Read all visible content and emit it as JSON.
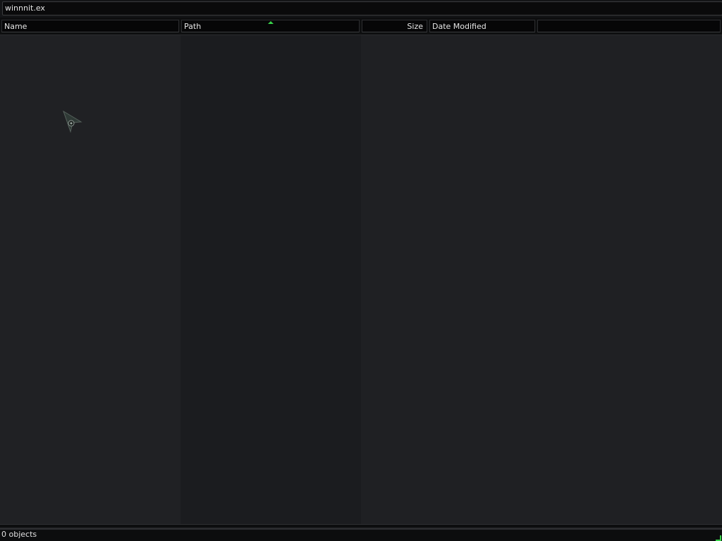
{
  "search": {
    "value": "winnnit.ex"
  },
  "columns": {
    "name": "Name",
    "path": "Path",
    "size": "Size",
    "date_modified": "Date Modified"
  },
  "sort": {
    "column": "Path",
    "direction": "ascending",
    "indicator_color": "#38d44a"
  },
  "results": [],
  "status": {
    "text": "0 objects"
  },
  "icons": {
    "sort": "sort-ascending-icon",
    "cursor": "mouse-pointer-icon",
    "grip": "resize-grip-icon"
  }
}
